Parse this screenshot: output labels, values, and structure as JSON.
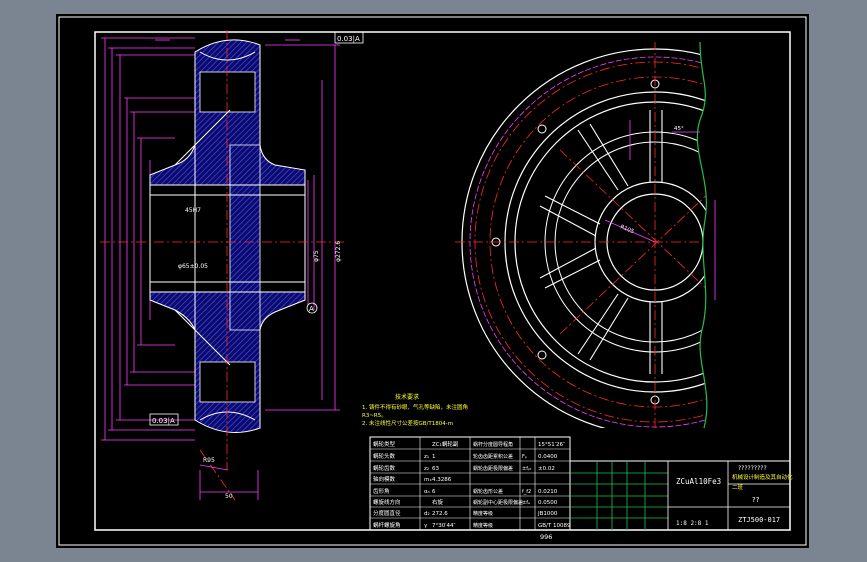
{
  "drawing": {
    "title_block": {
      "material": "ZCuAl10Fe3",
      "school_placeholder": "?????????",
      "school_name": "机械设计制造及其自动化",
      "class_label": "二班",
      "sheet_mark": "??",
      "drawing_number": "ZTJ500-017",
      "scale_row": "1:8 2:8 1"
    },
    "gear_table": {
      "rows": [
        {
          "label": "蜗轮类型",
          "value": "ZC₁蜗轮副",
          "label2": "蜗杆分度圆导程角",
          "value2": "15°51′26″"
        },
        {
          "label": "蜗轮头数",
          "sym": "z₁",
          "value": "1",
          "label2": "轮齿齿距累积公差",
          "sym2": "Fₚ",
          "value2": "0.0400"
        },
        {
          "label": "蜗轮齿数",
          "sym": "z₂",
          "value": "63",
          "label2": "蜗轮齿距极限偏差",
          "sym2": "±fₚₜ",
          "value2": "±0.02"
        },
        {
          "label": "轴向模数",
          "sym": "mₓ",
          "value": "4.3286",
          "label2": "",
          "sym2": "",
          "value2": ""
        },
        {
          "label": "齿形角",
          "sym": "αₙ",
          "value": "6",
          "label2": "蜗轮齿形公差",
          "sym2": "f_f2",
          "value2": "0.0210"
        },
        {
          "label": "螺旋线方向",
          "sym": "",
          "value": "右旋",
          "label2": "蜗轮副中心距极限偏差",
          "sym2": "±fₐ",
          "value2": "0.0500"
        },
        {
          "label": "分度圆直径",
          "sym": "d₂",
          "value": "272.6",
          "label2": "精度等级",
          "sym2": "",
          "value2": "JB1000"
        },
        {
          "label": "蜗杆螺旋角",
          "sym": "γ",
          "value": "7°30′44″",
          "label2": "精度等级",
          "sym2": "",
          "value2": "GB/T 10089"
        }
      ],
      "below": "996"
    },
    "tech_requirements": {
      "title": "技术要求",
      "items": [
        "1. 铸件不得有砂眼、气孔等缺陷，未注圆角",
        "R3~R5。",
        "2. 未注线性尺寸公差按GB/T1804-m"
      ]
    },
    "section_labels": {
      "tolerance_top": "0.03|A",
      "tolerance_bottom": "0.03|A",
      "datum": "A",
      "bore_label": "45H7",
      "hub_label": "φ75",
      "inner_label": "φ65±0.05",
      "bottom_dim": "50",
      "radius_label": "R95",
      "top_dim_right": "φ272.6"
    },
    "front_labels": {
      "radius_label": "R105",
      "angle_label": "45°"
    },
    "colors": {
      "background_outer": "#7b8591",
      "paper": "#000000",
      "frame_green": "#22c04a",
      "line_white": "#ffffff",
      "center_red": "#ff2a2a",
      "dimension_magenta": "#ff3cff",
      "hatch_blue": "#4040ff",
      "text_yellow": "#ffff33"
    }
  }
}
